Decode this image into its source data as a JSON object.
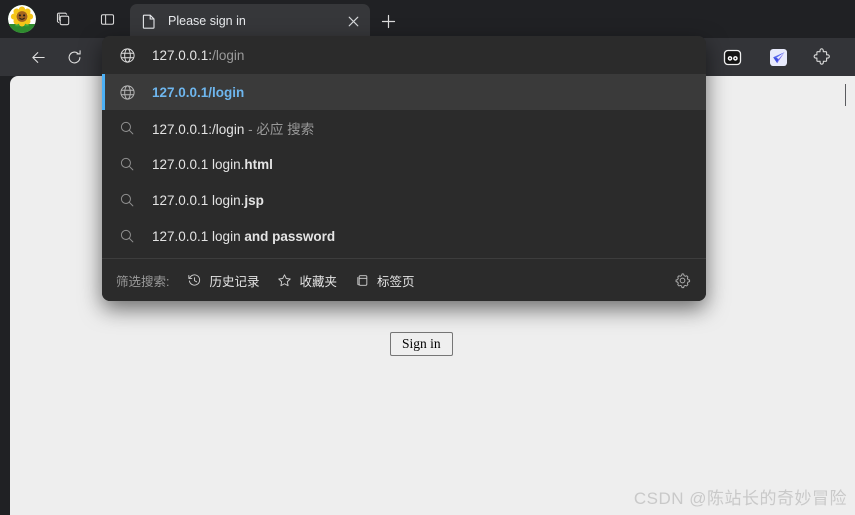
{
  "browser": {
    "avatar_name": "sunflower-avatar",
    "tab_groups_icon": "tab-groups-icon",
    "split_screen_icon": "split-screen-icon",
    "tab": {
      "title": "Please sign in",
      "favicon": "page-icon",
      "close_label": "×"
    },
    "new_tab_label": "+",
    "nav": {
      "back_icon": "back-arrow-icon",
      "reload_icon": "reload-icon"
    },
    "extensions": [
      {
        "name": "robot-face-extension-icon"
      },
      {
        "name": "blue-bird-extension-icon"
      },
      {
        "name": "puzzle-extensions-icon"
      }
    ]
  },
  "omnibox": {
    "input": {
      "icon": "globe-icon",
      "typed": "127.0.0.1:",
      "autocomplete": "/login"
    },
    "suggestions": [
      {
        "icon": "globe-icon",
        "selected": true,
        "plain": "",
        "bold": "127.0.0.1/login",
        "suffix": ""
      },
      {
        "icon": "search-icon",
        "selected": false,
        "plain": "127.0.0.1:/login",
        "bold": "",
        "suffix": " - 必应 搜索"
      },
      {
        "icon": "search-icon",
        "selected": false,
        "plain": "127.0.0.1 login.",
        "bold": "html",
        "suffix": ""
      },
      {
        "icon": "search-icon",
        "selected": false,
        "plain": "127.0.0.1 login.",
        "bold": "jsp",
        "suffix": ""
      },
      {
        "icon": "search-icon",
        "selected": false,
        "plain": "127.0.0.1 login ",
        "bold": "and password",
        "suffix": ""
      }
    ],
    "footer": {
      "label": "筛选搜索:",
      "filters": [
        {
          "icon": "history-clock-icon",
          "label": "历史记录"
        },
        {
          "icon": "star-icon",
          "label": "收藏夹"
        },
        {
          "icon": "tabs-icon",
          "label": "标签页"
        }
      ],
      "settings_icon": "gear-icon"
    }
  },
  "page": {
    "signin_button": "Sign in",
    "watermark": "CSDN @陈站长的奇妙冒险"
  },
  "colors": {
    "chrome_bg": "#202124",
    "toolbar_bg": "#333438",
    "tab_bg": "#36373a",
    "dropdown_bg": "#2b2b2b",
    "dropdown_selected_bg": "#3a3a3a",
    "accent_blue": "#4cb0f5",
    "suggestion_blue": "#6eb6ee",
    "page_bg": "#eeeeee"
  }
}
